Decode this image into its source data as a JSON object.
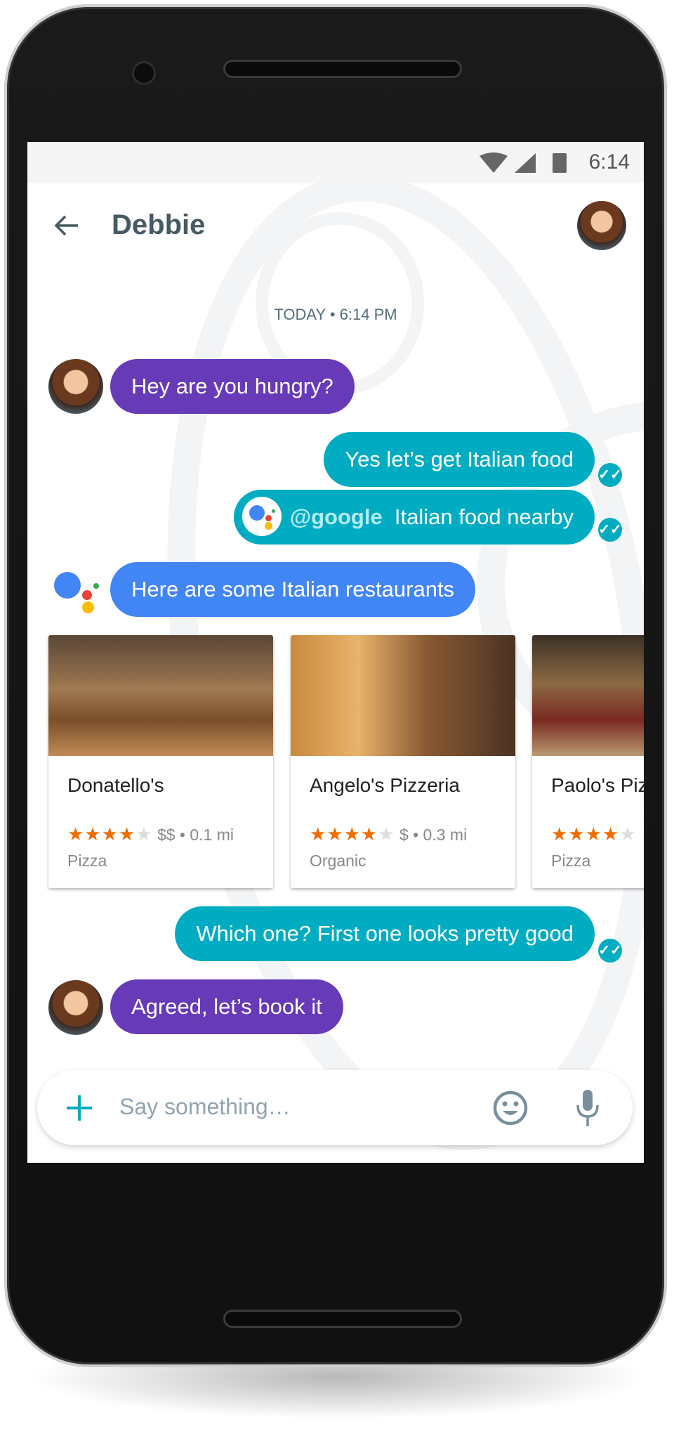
{
  "status_bar": {
    "time": "6:14",
    "icons": [
      "wifi-icon",
      "cell-signal-icon",
      "battery-icon"
    ]
  },
  "header": {
    "back_icon": "arrow-left-icon",
    "title": "Debbie"
  },
  "timestamp": "TODAY • 6:14 PM",
  "messages": [
    {
      "from": "Debbie",
      "text": "Hey are you hungry?"
    },
    {
      "from": "me",
      "text": "Yes let’s get Italian food",
      "status": "read"
    },
    {
      "from": "me",
      "mention": "@google",
      "text": "Italian food nearby",
      "status": "read"
    },
    {
      "from": "assistant",
      "text": "Here are some Italian restaurants"
    },
    {
      "from": "me",
      "text": "Which one? First one looks pretty good",
      "status": "read"
    },
    {
      "from": "Debbie",
      "text": "Agreed, let’s book it"
    }
  ],
  "cards": [
    {
      "name": "Donatello's",
      "rating": 4,
      "price": "$$ • 0.1 mi",
      "category": "Pizza"
    },
    {
      "name": "Angelo's Pizzeria",
      "rating": 4,
      "price": "$ • 0.3 mi",
      "category": "Organic"
    },
    {
      "name": "Paolo's Pizzeria",
      "rating": 4,
      "price": "",
      "category": "Pizza"
    }
  ],
  "composer": {
    "placeholder": "Say something…",
    "add_icon": "plus-icon",
    "emoji_icon": "emoji-icon",
    "mic_icon": "mic-icon"
  },
  "navbar": {
    "icons": [
      "back-triangle-icon",
      "home-circle-icon",
      "recents-square-icon"
    ]
  },
  "colors": {
    "incoming": "#673ab7",
    "outgoing": "#00acc1",
    "assistant": "#4285f4",
    "stars": "#ef6c00"
  }
}
